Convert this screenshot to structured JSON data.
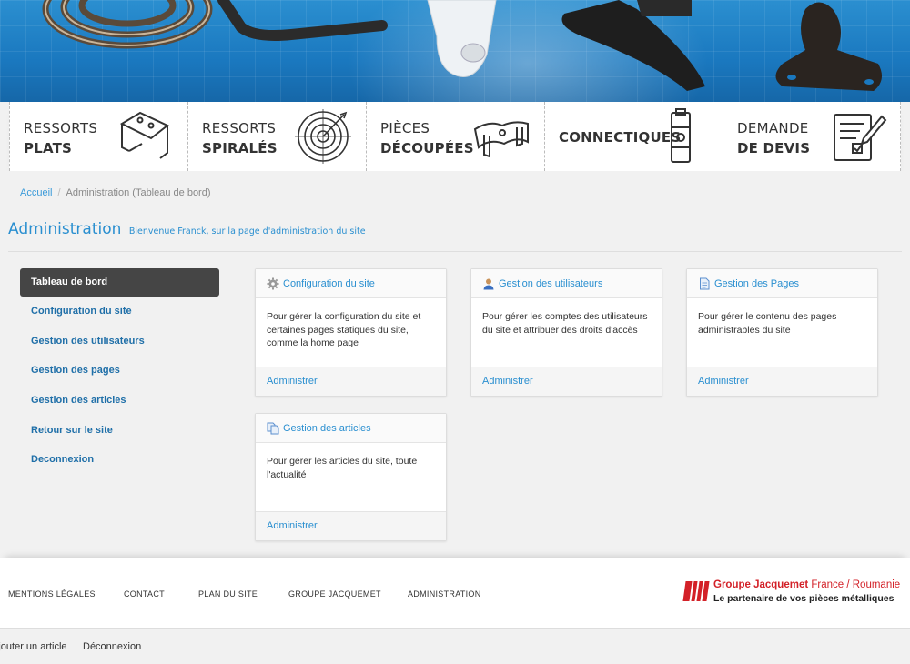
{
  "nav": {
    "items": [
      {
        "line1": "RESSORTS",
        "line2": "PLATS"
      },
      {
        "line1": "RESSORTS",
        "line2": "SPIRALÉS"
      },
      {
        "line1": "PIÈCES",
        "line2": "DÉCOUPÉES"
      },
      {
        "line1": "",
        "line2": "CONNECTIQUES"
      },
      {
        "line1": "DEMANDE",
        "line2": "DE DEVIS"
      }
    ],
    "icons": [
      "flat-spring-icon",
      "spiral-spring-icon",
      "cut-part-icon",
      "connector-icon",
      "quote-request-icon"
    ]
  },
  "breadcrumb": {
    "home": "Accueil",
    "separator": "/",
    "current": "Administration (Tableau de bord)"
  },
  "page": {
    "title": "Administration",
    "subtitle": "Bienvenue Franck, sur la page d'administration du site"
  },
  "sidebar": {
    "items": [
      {
        "label": "Tableau de bord"
      },
      {
        "label": "Configuration du site"
      },
      {
        "label": "Gestion des utilisateurs"
      },
      {
        "label": "Gestion des pages"
      },
      {
        "label": "Gestion des articles"
      },
      {
        "label": "Retour sur le site"
      },
      {
        "label": "Deconnexion"
      }
    ]
  },
  "cards": [
    {
      "title": "Configuration du site",
      "icon": "gear-icon",
      "text": "Pour gérer la configuration du site et certaines pages statiques du site, comme la home page",
      "link": "Administrer"
    },
    {
      "title": "Gestion des utilisateurs",
      "icon": "user-icon",
      "text": "Pour gérer les comptes des utilisateurs du site et attribuer des droits d'accès",
      "link": "Administrer"
    },
    {
      "title": "Gestion des Pages",
      "icon": "page-icon",
      "text": "Pour gérer le contenu des pages administrables du site",
      "link": "Administrer"
    },
    {
      "title": "Gestion des articles",
      "icon": "articles-icon",
      "text": "Pour gérer les articles du site, toute l'actualité",
      "link": "Administrer"
    }
  ],
  "footer": {
    "links": [
      "MENTIONS LÉGALES",
      "CONTACT",
      "PLAN DU SITE",
      "GROUPE JACQUEMET",
      "ADMINISTRATION"
    ],
    "brand_name": "Groupe Jacquemet",
    "brand_region": "France / Roumanie",
    "brand_tagline": "Le partenaire de vos pièces métalliques"
  },
  "bottombar": {
    "links": [
      "Ajouter un article",
      "Déconnexion"
    ]
  },
  "colors": {
    "accent": "#2a8fd0",
    "link": "#1f6fa8",
    "brand": "#d32128",
    "sidebar_active": "#454545"
  }
}
